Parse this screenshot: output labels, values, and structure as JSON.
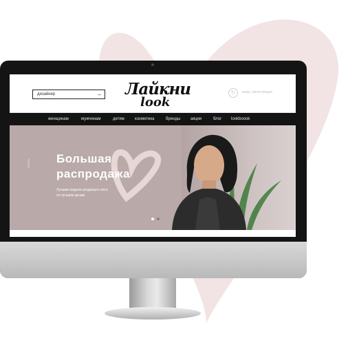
{
  "site": {
    "search": {
      "placeholder": "дизайнер",
      "arrow_icon": "arrow-right-icon"
    },
    "logo": {
      "line1": "Лайкни",
      "line2": "look"
    },
    "login": {
      "label": "вход / регистрация",
      "icon": "user-icon"
    },
    "nav": [
      "женщинам",
      "мужчинам",
      "детям",
      "косметика",
      "бренды",
      "акции",
      "блог",
      "lookboook"
    ],
    "hero": {
      "side_label": "СТИЛЬ",
      "title_line1": "Большая",
      "title_line2": "распродажа",
      "subtitle": "Лучшие модели уходящего лета по лучшим ценам",
      "active_slide": 1,
      "slide_count": 2
    }
  },
  "colors": {
    "heart": "#f1e3e3",
    "hero_bg": "#b9a9a8",
    "nav_bg": "#141414"
  }
}
